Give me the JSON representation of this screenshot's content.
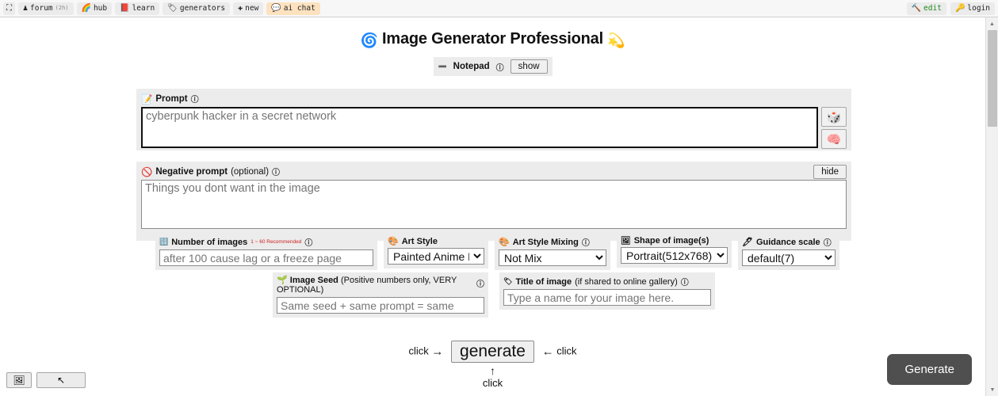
{
  "topbar": {
    "left_items": [
      {
        "icon": "grid-icon",
        "glyph": "⛶",
        "label": "",
        "sub": "",
        "active": false
      },
      {
        "icon": "forum-icon",
        "glyph": "♟",
        "label": "forum",
        "sub": "(2h)",
        "active": false
      },
      {
        "icon": "rainbow-icon",
        "glyph": "🌈",
        "label": "hub",
        "sub": "",
        "active": false
      },
      {
        "icon": "book-icon",
        "glyph": "📕",
        "label": "learn",
        "sub": "",
        "active": false
      },
      {
        "icon": "tag-icon",
        "glyph": "🏷",
        "label": "generators",
        "sub": "",
        "active": false
      },
      {
        "icon": "plus-icon",
        "glyph": "✚",
        "label": "new",
        "sub": "",
        "active": false
      },
      {
        "icon": "chat-icon",
        "glyph": "💬",
        "label": "ai chat",
        "sub": "",
        "active": true
      }
    ],
    "right_items": [
      {
        "icon": "hammer-icon",
        "glyph": "🔨",
        "label": "edit",
        "color": "#1d8a1d"
      },
      {
        "icon": "key-icon",
        "glyph": "🔑",
        "label": "login",
        "color": "#222222"
      }
    ]
  },
  "header": {
    "title": "Image Generator Professional",
    "left_icon": "swirl-icon",
    "left_glyph": "🌀",
    "right_icon": "sparkle-icon",
    "right_glyph": "💫"
  },
  "notepad": {
    "label": "Notepad",
    "dash": "➖",
    "info": "ⓘ",
    "show_label": "show"
  },
  "prompt": {
    "label": "Prompt",
    "icon": "memo-icon",
    "glyph": "📝",
    "info": "ⓘ",
    "value": "",
    "placeholder": "cyberpunk hacker in a secret network",
    "dice_icon": "dice-icon",
    "dice_glyph": "🎲",
    "brain_icon": "brain-icon",
    "brain_glyph": "🧠"
  },
  "negative_prompt": {
    "label": "Negative prompt",
    "label_note": "(optional)",
    "icon": "prohibited-icon",
    "glyph": "🚫",
    "info": "ⓘ",
    "value": "",
    "placeholder": "Things you dont want in the image",
    "hide_label": "hide"
  },
  "options": {
    "number_of_images": {
      "label": "Number of images",
      "hint": "1 ~ 60 Recommended",
      "icon": "counter-icon",
      "glyph": "🔢",
      "info": "ⓘ",
      "value": "",
      "placeholder": "after 100 cause lag or a freeze page"
    },
    "art_style": {
      "label": "Art Style",
      "icon": "palette-icon",
      "glyph": "🎨",
      "selected": "Painted Anime Pl",
      "options": [
        "Painted Anime Pl"
      ]
    },
    "art_style_mixing": {
      "label": "Art Style Mixing",
      "icon": "palette-icon",
      "glyph": "🎨",
      "info": "ⓘ",
      "selected": "Not Mix",
      "options": [
        "Not Mix"
      ]
    },
    "shape_of_images": {
      "label": "Shape of image(s)",
      "icon": "frame-icon",
      "glyph": "🖼",
      "selected": "Portrait(512x768)",
      "options": [
        "Portrait(512x768)"
      ]
    },
    "guidance_scale": {
      "label": "Guidance scale",
      "icon": "pen-icon",
      "glyph": "🖊",
      "info": "ⓘ",
      "selected": "default(7)",
      "options": [
        "default(7)"
      ]
    },
    "image_seed": {
      "label": "Image Seed",
      "label_note": "(Positive numbers only, VERY OPTIONAL)",
      "icon": "seedling-icon",
      "glyph": "🌱",
      "info": "ⓘ",
      "value": "",
      "placeholder": "Same seed + same prompt = same"
    },
    "title_of_image": {
      "label": "Title of image",
      "label_note": "(if shared to online gallery)",
      "icon": "label-icon",
      "glyph": "🏷",
      "info": "ⓘ",
      "value": "",
      "placeholder": "Type a name for your image here."
    }
  },
  "generate_hint": {
    "left_text": "click",
    "left_arrow": "→",
    "button_label": "generate",
    "right_arrow": "←",
    "right_text": "click",
    "up_arrow": "↑",
    "below_text": "click"
  },
  "floating_generate": {
    "label": "Generate",
    "bg": "#4f4f4f"
  },
  "taskbar": [
    {
      "name": "image-window-icon",
      "glyph": "🖼",
      "wide": false
    },
    {
      "name": "cursor-icon",
      "glyph": "↖",
      "wide": true
    }
  ],
  "scrollbar": {
    "up_glyph": "▲",
    "down_glyph": "▼"
  }
}
